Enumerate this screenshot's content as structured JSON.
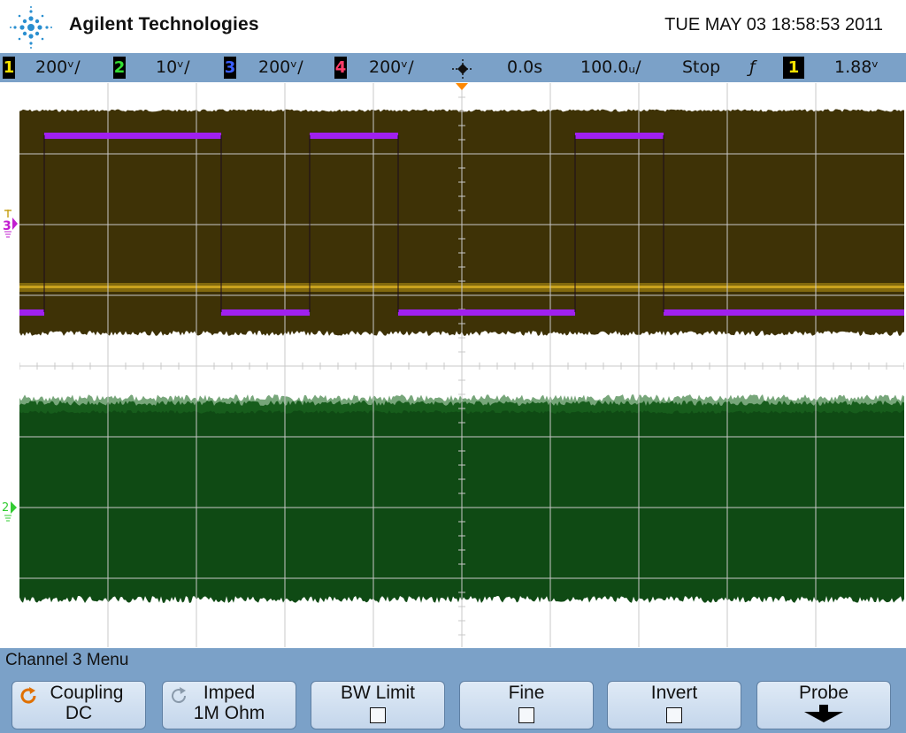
{
  "header": {
    "brand": "Agilent Technologies",
    "datetime": "TUE MAY 03 18:58:53 2011"
  },
  "statusbar": {
    "channels": [
      {
        "num": "1",
        "scale": "200ᵛ/",
        "color": "#f6e200"
      },
      {
        "num": "2",
        "scale": "10ᵛ/",
        "color": "#33dd33"
      },
      {
        "num": "3",
        "scale": "200ᵛ/",
        "color": "#3a5fff"
      },
      {
        "num": "4",
        "scale": "200ᵛ/",
        "color": "#ff3c6a"
      }
    ],
    "delay": "0.0s",
    "timebase": "100.0ᵤ/",
    "run_state": "Stop",
    "trigger_slope": "ƒ",
    "trigger_source": "1",
    "trigger_source_color": "#f6e200",
    "trigger_level": "1.88ᵛ"
  },
  "markers": {
    "ch3": "3",
    "ch2": "2"
  },
  "colors": {
    "ch1_band": "#3e3206",
    "ch1_trace": "#c9a21e",
    "ch2_band": "#0f4a14",
    "ch3_trace": "#a020f0",
    "grid": "#c8c8c8",
    "trigger_marker": "#ff8800"
  },
  "menu": {
    "title": "Channel 3  Menu",
    "softkeys": [
      {
        "label": "Coupling",
        "value": "DC",
        "icon": "rotate-icon"
      },
      {
        "label": "Imped",
        "value": "1M Ohm",
        "icon": "rotate-icon"
      },
      {
        "label": "BW Limit",
        "checkbox": true
      },
      {
        "label": "Fine",
        "checkbox": true
      },
      {
        "label": "Invert",
        "checkbox": true
      },
      {
        "label": "Probe",
        "icon": "down-arrow-icon"
      }
    ]
  }
}
